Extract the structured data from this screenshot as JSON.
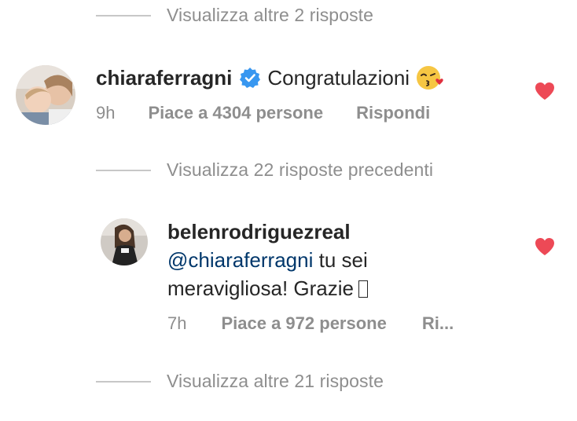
{
  "thread": {
    "view_more_top": "Visualizza altre 2 risposte",
    "view_previous": "Visualizza 22 risposte precedenti",
    "view_more_bottom": "Visualizza altre 21 risposte"
  },
  "comment1": {
    "username": "chiaraferragni",
    "verified": true,
    "text": "Congratulazioni",
    "emoji": "kissing-face-emoji",
    "time": "9h",
    "likes": "Piace a 4304 persone",
    "reply": "Rispondi",
    "liked": true,
    "heart_color": "#ed4956"
  },
  "comment2": {
    "username": "belenrodriguezreal",
    "mention": "@chiaraferragni",
    "text_after_mention": " tu sei",
    "text_line2": "meravigliosa! Grazie",
    "time": "7h",
    "likes": "Piace a 972 persone",
    "reply": "Ri...",
    "liked": true,
    "heart_color": "#ed4956"
  }
}
